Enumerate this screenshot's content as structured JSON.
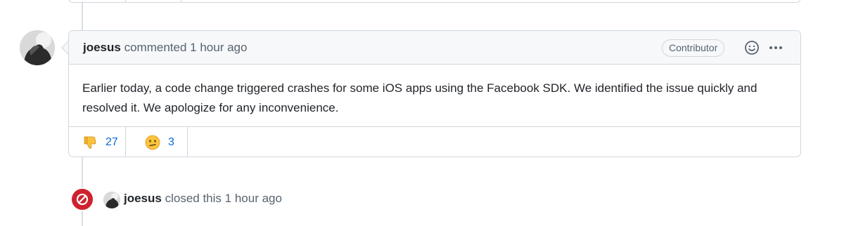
{
  "comment": {
    "author": "joesus",
    "action": "commented",
    "time": "1 hour ago",
    "badge": "Contributor",
    "body": "Earlier today, a code change triggered crashes for some iOS apps using the Facebook SDK. We identified the issue quickly and resolved it. We apologize for any inconvenience.",
    "reactions": [
      {
        "icon": "thumbs-down-icon",
        "count": "27"
      },
      {
        "icon": "confused-face-icon",
        "count": "3"
      }
    ],
    "add_reaction_icon": "smiley-icon",
    "menu_icon": "kebab-icon"
  },
  "event": {
    "icon": "closed-icon",
    "author": "joesus",
    "action": "closed this",
    "time": "1 hour ago"
  },
  "colors": {
    "closed": "#cf222e",
    "link": "#0969da",
    "border": "#d0d7de",
    "header_bg": "#f6f8fa"
  }
}
